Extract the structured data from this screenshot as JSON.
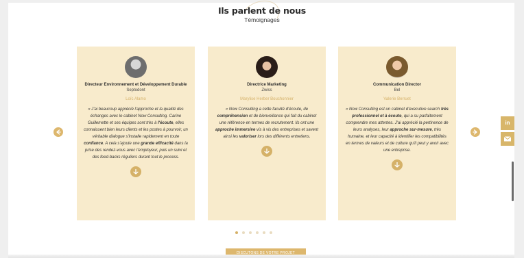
{
  "header": {
    "title": "Ils parlent de nous",
    "subtitle": "Témoignages"
  },
  "testimonials": [
    {
      "role": "Directeur Environnement et Développement Durable",
      "company": "Septodont",
      "person": "Loïc Alamo",
      "quote": [
        {
          "t": "« J'ai beaucoup apprécié l'approche et la qualité des échanges avec le cabinet Now Consulting. Carine Guillemette et ses équipes sont très à "
        },
        {
          "t": "l'écoute",
          "b": true
        },
        {
          "t": ", elles connaissent bien leurs clients et les postes à pourvoir, un véritable dialogue s'installe rapidement en toute "
        },
        {
          "t": "confiance",
          "b": true
        },
        {
          "t": ". A cela s'ajoute une "
        },
        {
          "t": "grande efficacité",
          "b": true
        },
        {
          "t": " dans la prise des rendez-vous avec l'employeur, puis un suivi et des feed-backs réguliers durant tout le process."
        }
      ],
      "avatar_colors": [
        "#8f8f8f",
        "#e6e6e6"
      ]
    },
    {
      "role": "Directrice Marketing",
      "company": "Zwiss",
      "person": "Marylise Herber Bouchonnier",
      "quote": [
        {
          "t": "« Now Consulting a cette faculté d'écoute, de "
        },
        {
          "t": "compréhension",
          "b": true
        },
        {
          "t": " et de bienveillance qui fait du cabinet une référence en termes de recrutement. Ils ont une "
        },
        {
          "t": "approche immersive",
          "b": true
        },
        {
          "t": " vis à vis des entreprises et savent ainsi les "
        },
        {
          "t": "valoriser",
          "b": true
        },
        {
          "t": " lors des différents entretiens."
        }
      ],
      "avatar_colors": [
        "#3a2a24",
        "#f1d6c2"
      ]
    },
    {
      "role": "Communication Director",
      "company": "Bel",
      "person": "Valerie Berruet",
      "quote": [
        {
          "t": "« Now Consulting est un cabinet d'executive search "
        },
        {
          "t": "très professionnel et à écoute",
          "b": true
        },
        {
          "t": ", qui a su parfaitement comprendre mes attentes. J'ai apprécié la pertinence de leurs analyses, leur "
        },
        {
          "t": "approche sur-mesure",
          "b": true
        },
        {
          "t": ", très humaine, et leur capacité à identifier les compatibilités en termes de valeurs et de culture qu'il peut y avoir avec une entreprise."
        }
      ],
      "avatar_colors": [
        "#7a5a2e",
        "#f0c9a8"
      ]
    }
  ],
  "carousel": {
    "dots_count": 6,
    "active_dot": 0
  },
  "cta": {
    "label": "DISCUTONS DE VOTRE PROJET"
  },
  "social": [
    {
      "icon": "linkedin-icon",
      "label": "in"
    },
    {
      "icon": "mail-icon",
      "label": ""
    }
  ],
  "colors": {
    "accent": "#d5b168",
    "card_bg": "#f8ebcc",
    "background": "#ffffff"
  }
}
